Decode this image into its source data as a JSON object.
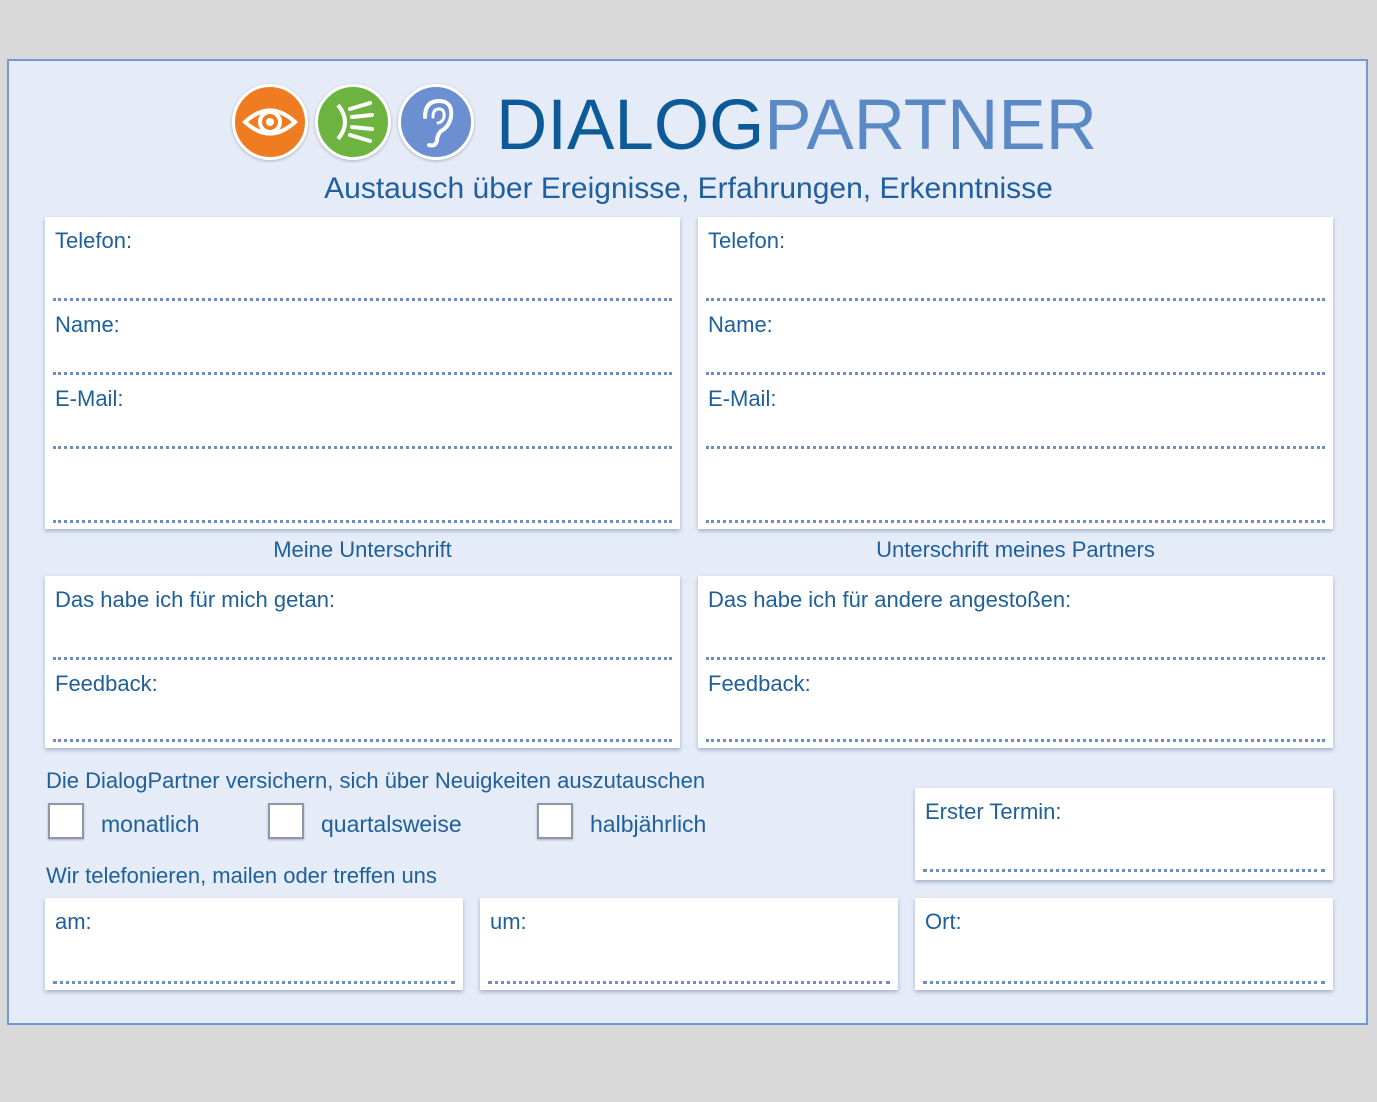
{
  "brand": {
    "name_part1": "DIALOG",
    "name_part2": "PARTNER",
    "tagline": "Austausch über Ereignisse, Erfahrungen, Erkenntnisse",
    "icons": [
      "eye-icon",
      "speech-icon",
      "ear-icon"
    ],
    "colors": {
      "orange": "#f07c22",
      "green": "#6cb33f",
      "blue": "#6b8fd0",
      "dark_blue": "#0c5a98",
      "light_blue": "#5a8ac6"
    }
  },
  "left_contact": {
    "telefon_label": "Telefon:",
    "name_label": "Name:",
    "email_label": "E-Mail:",
    "signature_caption": "Meine Unterschrift"
  },
  "right_contact": {
    "telefon_label": "Telefon:",
    "name_label": "Name:",
    "email_label": "E-Mail:",
    "signature_caption": "Unterschrift meines Partners"
  },
  "left_notes": {
    "done_label": "Das habe ich für mich getan:",
    "feedback_label": "Feedback:"
  },
  "right_notes": {
    "done_label": "Das habe ich für andere angestoßen:",
    "feedback_label": "Feedback:"
  },
  "agreement": {
    "text": "Die DialogPartner versichern, sich über Neuigkeiten auszutauschen",
    "options": [
      "monatlich",
      "quartalsweise",
      "halbjährlich"
    ],
    "first_meeting_label": "Erster Termin:"
  },
  "meeting": {
    "text": "Wir telefonieren, mailen oder treffen uns",
    "am_label": "am:",
    "um_label": "um:",
    "ort_label": "Ort:"
  }
}
